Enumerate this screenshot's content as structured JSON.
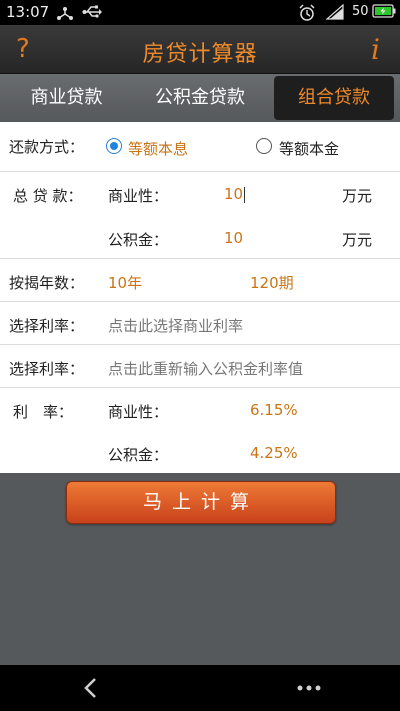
{
  "status_bar": {
    "time": "13:07",
    "signal_label": "50"
  },
  "title_bar": {
    "help_label": "?",
    "title": "房贷计算器",
    "info_label": "i"
  },
  "tabs": [
    {
      "label": "商业贷款",
      "selected": false
    },
    {
      "label": "公积金贷款",
      "selected": false
    },
    {
      "label": "组合贷款",
      "selected": true
    }
  ],
  "form": {
    "repay_label": "还款方式：",
    "repay_options": [
      {
        "label": "等额本息",
        "checked": true
      },
      {
        "label": "等额本金",
        "checked": false
      }
    ],
    "total_label": "总 贷 款：",
    "commercial_label": "商业性：",
    "commercial_value": "10",
    "commercial_unit": "万元",
    "fund_label": "公积金：",
    "fund_value": "10",
    "fund_unit": "万元",
    "years_label": "按揭年数：",
    "years_value": "10年",
    "periods_value": "120期",
    "rate_select_label": "选择利率：",
    "rate_select_placeholder": "点击此选择商业利率",
    "rate_input_label": "选择利率：",
    "rate_input_placeholder": "点击此重新输入公积金利率值",
    "rate_label": "利　率：",
    "rate_commercial_label": "商业性：",
    "rate_commercial_value": "6.15%",
    "rate_fund_label": "公积金：",
    "rate_fund_value": "4.25%"
  },
  "calc_button": "马上计算",
  "colors": {
    "accent": "#ef8a2a",
    "value": "#c97416",
    "button": "#e0612a",
    "radio": "#1f86e0"
  }
}
